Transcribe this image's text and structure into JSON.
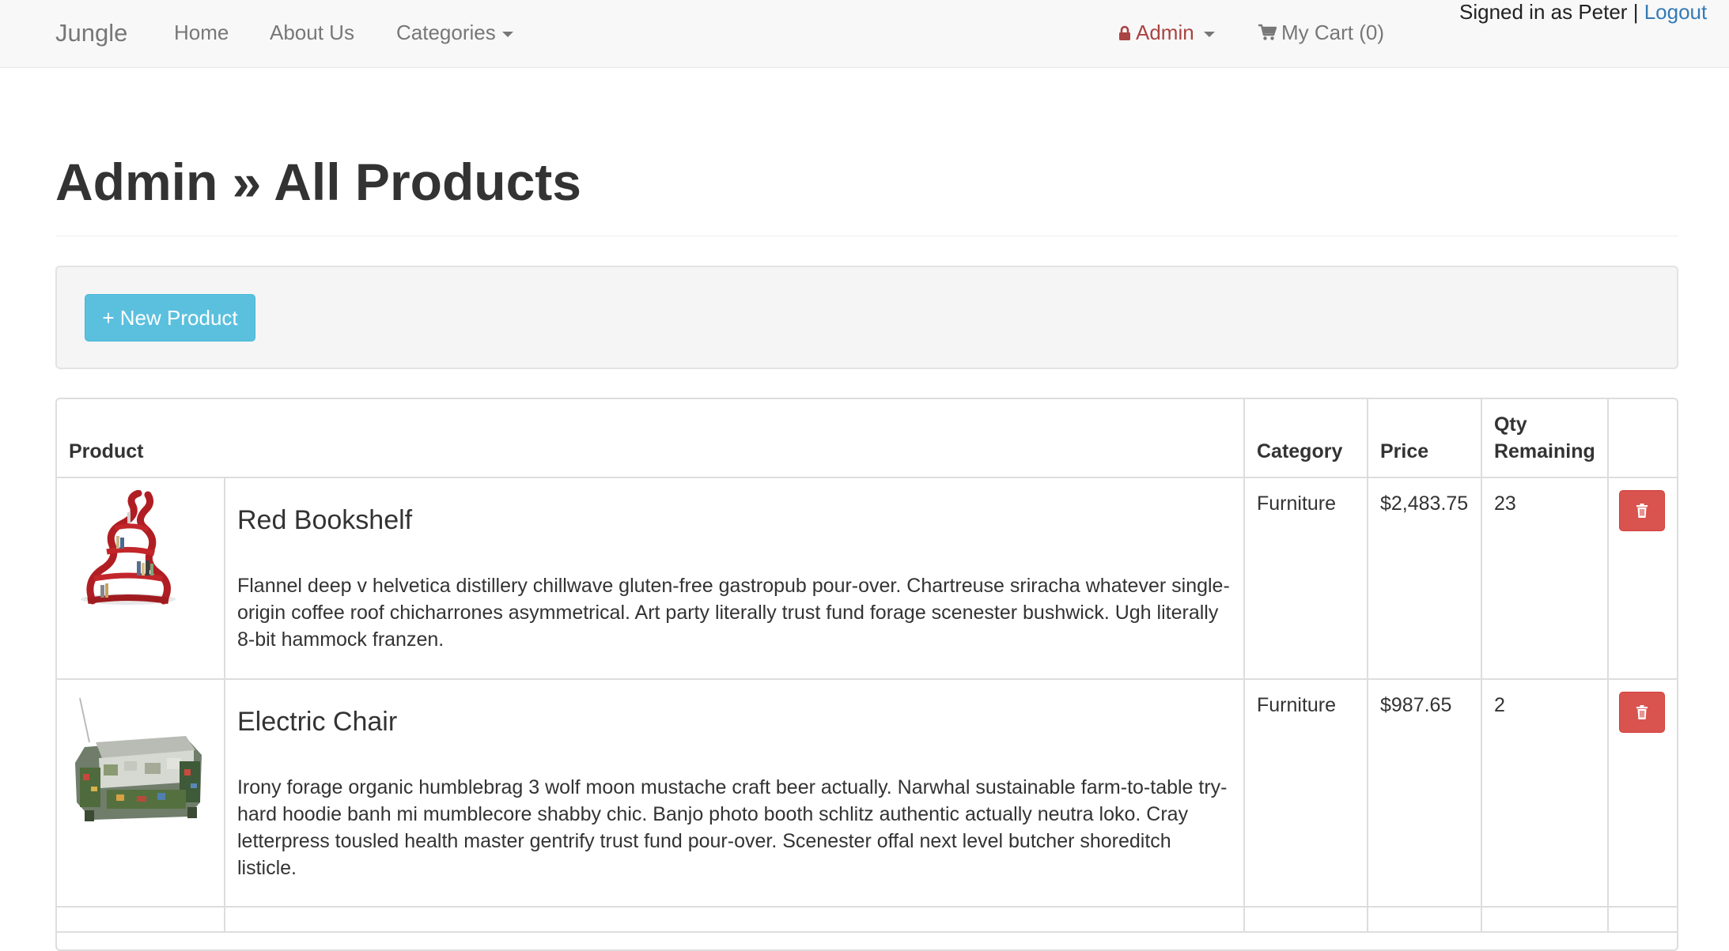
{
  "navbar": {
    "brand": "Jungle",
    "home": "Home",
    "about": "About Us",
    "categories": "Categories",
    "admin": "Admin",
    "cart": "My Cart (0)",
    "signed_in": "Signed in as Peter",
    "separator": "|",
    "logout": "Logout",
    "admin_color": "#a94442",
    "link_color": "#337ab7"
  },
  "page": {
    "title": "Admin » All Products"
  },
  "toolbar": {
    "new_product": "+ New Product",
    "new_product_color": "#5bc0de"
  },
  "table": {
    "headers": {
      "product": "Product",
      "category": "Category",
      "price": "Price",
      "qty_line1": "Qty",
      "qty_line2": "Remaining"
    },
    "rows": [
      {
        "name": "Red Bookshelf",
        "description": "Flannel deep v helvetica distillery chillwave gluten-free gastropub pour-over. Chartreuse sriracha whatever single-origin coffee roof chicharrones asymmetrical. Art party literally trust fund forage scenester bushwick. Ugh literally 8-bit hammock franzen.",
        "category": "Furniture",
        "price": "$2,483.75",
        "qty": "23",
        "image": "red-bookshelf-image"
      },
      {
        "name": "Electric Chair",
        "description": "Irony forage organic humblebrag 3 wolf moon mustache craft beer actually. Narwhal sustainable farm-to-table try-hard hoodie banh mi mumblecore shabby chic. Banjo photo booth schlitz authentic actually neutra loko. Cray letterpress tousled health master gentrify trust fund pour-over. Scenester offal next level butcher shoreditch listicle.",
        "category": "Furniture",
        "price": "$987.65",
        "qty": "2",
        "image": "electric-chair-image"
      }
    ],
    "delete_color": "#d9534f",
    "delete_icon": "trash-icon"
  }
}
